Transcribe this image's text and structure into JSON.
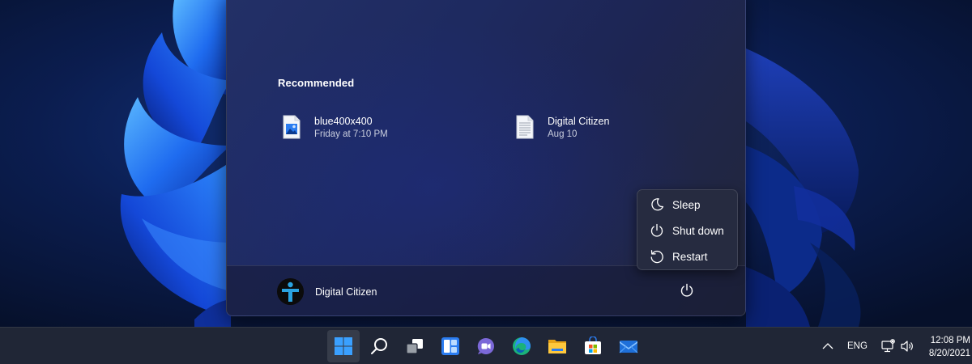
{
  "start_menu": {
    "recommended_title": "Recommended",
    "recommended": [
      {
        "name": "blue400x400",
        "date": "Friday at 7:10 PM",
        "icon": "image-file-icon"
      },
      {
        "name": "Digital Citizen",
        "date": "Aug 10",
        "icon": "text-document-icon"
      }
    ],
    "user": {
      "name": "Digital Citizen",
      "avatar_icon": "digital-citizen-logo"
    },
    "power_icon": "power-icon"
  },
  "power_menu": {
    "items": [
      {
        "label": "Sleep",
        "icon": "moon-icon"
      },
      {
        "label": "Shut down",
        "icon": "power-icon"
      },
      {
        "label": "Restart",
        "icon": "restart-icon"
      }
    ]
  },
  "taskbar": {
    "apps": [
      "windows-start-icon",
      "search-icon",
      "task-view-icon",
      "widgets-icon",
      "teams-chat-icon",
      "edge-icon",
      "file-explorer-icon",
      "store-icon",
      "mail-icon"
    ],
    "tray": {
      "language": "ENG",
      "time": "12:08 PM",
      "date": "8/20/2021"
    }
  },
  "colors": {
    "accent": "#2b7cf0",
    "taskbar_bg": "#202636",
    "menu_bg": "#262b40"
  }
}
